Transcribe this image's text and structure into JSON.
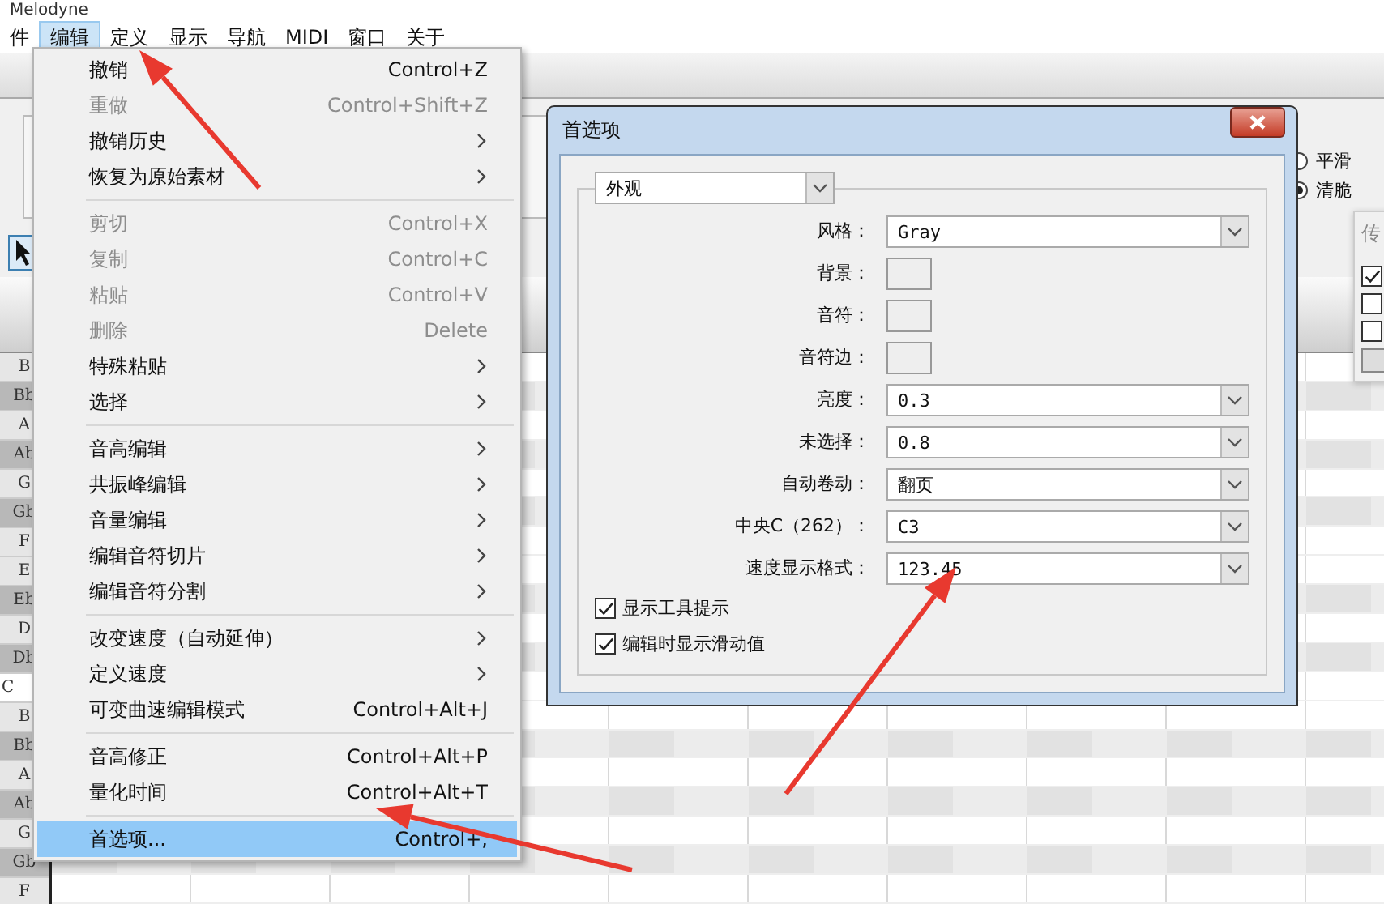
{
  "window": {
    "title": "Melodyne"
  },
  "menubar": [
    {
      "label": "件",
      "selected": false
    },
    {
      "label": "编辑",
      "selected": true
    },
    {
      "label": "定义",
      "selected": false
    },
    {
      "label": "显示",
      "selected": false
    },
    {
      "label": "导航",
      "selected": false
    },
    {
      "label": "MIDI",
      "selected": false
    },
    {
      "label": "窗口",
      "selected": false
    },
    {
      "label": "关于",
      "selected": false
    }
  ],
  "render_options": [
    {
      "label": "平滑",
      "selected": false
    },
    {
      "label": "清脆",
      "selected": true
    }
  ],
  "side_panel": {
    "title": "传",
    "checkboxes": [
      {
        "checked": true
      },
      {
        "checked": false
      },
      {
        "checked": false
      }
    ]
  },
  "piano_roll": {
    "keys": [
      {
        "label": "B",
        "kind": "white"
      },
      {
        "label": "Bb",
        "kind": "black"
      },
      {
        "label": "A",
        "kind": "white"
      },
      {
        "label": "Ab",
        "kind": "black"
      },
      {
        "label": "G",
        "kind": "white"
      },
      {
        "label": "Gb",
        "kind": "black"
      },
      {
        "label": "F",
        "kind": "white"
      },
      {
        "label": "E",
        "kind": "white"
      },
      {
        "label": "Eb",
        "kind": "black"
      },
      {
        "label": "D",
        "kind": "white"
      },
      {
        "label": "Db",
        "kind": "black"
      },
      {
        "label": "C",
        "kind": "c"
      },
      {
        "label": "B",
        "kind": "white"
      },
      {
        "label": "Bb",
        "kind": "black"
      },
      {
        "label": "A",
        "kind": "white"
      },
      {
        "label": "Ab",
        "kind": "black"
      },
      {
        "label": "G",
        "kind": "white"
      },
      {
        "label": "Gb",
        "kind": "black"
      },
      {
        "label": "F",
        "kind": "white"
      }
    ]
  },
  "edit_menu": {
    "sections": [
      {
        "items": [
          {
            "label": "撤销",
            "shortcut": "Control+Z",
            "submenu": false,
            "disabled": false,
            "selected": false
          },
          {
            "label": "重做",
            "shortcut": "Control+Shift+Z",
            "submenu": false,
            "disabled": true,
            "selected": false
          },
          {
            "label": "撤销历史",
            "submenu": true,
            "disabled": false,
            "selected": false
          },
          {
            "label": "恢复为原始素材",
            "submenu": true,
            "disabled": false,
            "selected": false
          }
        ]
      },
      {
        "items": [
          {
            "label": "剪切",
            "shortcut": "Control+X",
            "submenu": false,
            "disabled": true,
            "selected": false
          },
          {
            "label": "复制",
            "shortcut": "Control+C",
            "submenu": false,
            "disabled": true,
            "selected": false
          },
          {
            "label": "粘贴",
            "shortcut": "Control+V",
            "submenu": false,
            "disabled": true,
            "selected": false
          },
          {
            "label": "删除",
            "shortcut": "Delete",
            "submenu": false,
            "disabled": true,
            "selected": false
          },
          {
            "label": "特殊粘贴",
            "submenu": true,
            "disabled": false,
            "selected": false
          },
          {
            "label": "选择",
            "submenu": true,
            "disabled": false,
            "selected": false
          }
        ]
      },
      {
        "items": [
          {
            "label": "音高编辑",
            "submenu": true,
            "disabled": false,
            "selected": false
          },
          {
            "label": "共振峰编辑",
            "submenu": true,
            "disabled": false,
            "selected": false
          },
          {
            "label": "音量编辑",
            "submenu": true,
            "disabled": false,
            "selected": false
          },
          {
            "label": "编辑音符切片",
            "submenu": true,
            "disabled": false,
            "selected": false
          },
          {
            "label": "编辑音符分割",
            "submenu": true,
            "disabled": false,
            "selected": false
          }
        ]
      },
      {
        "items": [
          {
            "label": "改变速度（自动延伸）",
            "submenu": true,
            "disabled": false,
            "selected": false
          },
          {
            "label": "定义速度",
            "submenu": true,
            "disabled": false,
            "selected": false
          },
          {
            "label": "可变曲速编辑模式",
            "shortcut": "Control+Alt+J",
            "submenu": false,
            "disabled": false,
            "selected": false
          }
        ]
      },
      {
        "items": [
          {
            "label": "音高修正",
            "shortcut": "Control+Alt+P",
            "submenu": false,
            "disabled": false,
            "selected": false
          },
          {
            "label": "量化时间",
            "shortcut": "Control+Alt+T",
            "submenu": false,
            "disabled": false,
            "selected": false
          }
        ]
      },
      {
        "items": [
          {
            "label": "首选项...",
            "shortcut": "Control+,",
            "submenu": false,
            "disabled": false,
            "selected": true
          }
        ]
      }
    ]
  },
  "dialog": {
    "title": "首选项",
    "category": "外观",
    "rows": [
      {
        "label": "风格：",
        "kind": "combo",
        "value": "Gray"
      },
      {
        "label": "背景：",
        "kind": "swatch"
      },
      {
        "label": "音符：",
        "kind": "swatch"
      },
      {
        "label": "音符边：",
        "kind": "swatch"
      },
      {
        "label": "亮度：",
        "kind": "combo",
        "value": "0.3"
      },
      {
        "label": "未选择：",
        "kind": "combo",
        "value": "0.8"
      },
      {
        "label": "自动卷动：",
        "kind": "combo",
        "value": "翻页"
      },
      {
        "label": "中央C（262）：",
        "kind": "combo",
        "value": "C3"
      },
      {
        "label": "速度显示格式：",
        "kind": "combo",
        "value": "123.45"
      }
    ],
    "checkboxes": [
      {
        "label": "显示工具提示",
        "checked": true
      },
      {
        "label": "编辑时显示滑动值",
        "checked": true
      }
    ]
  }
}
